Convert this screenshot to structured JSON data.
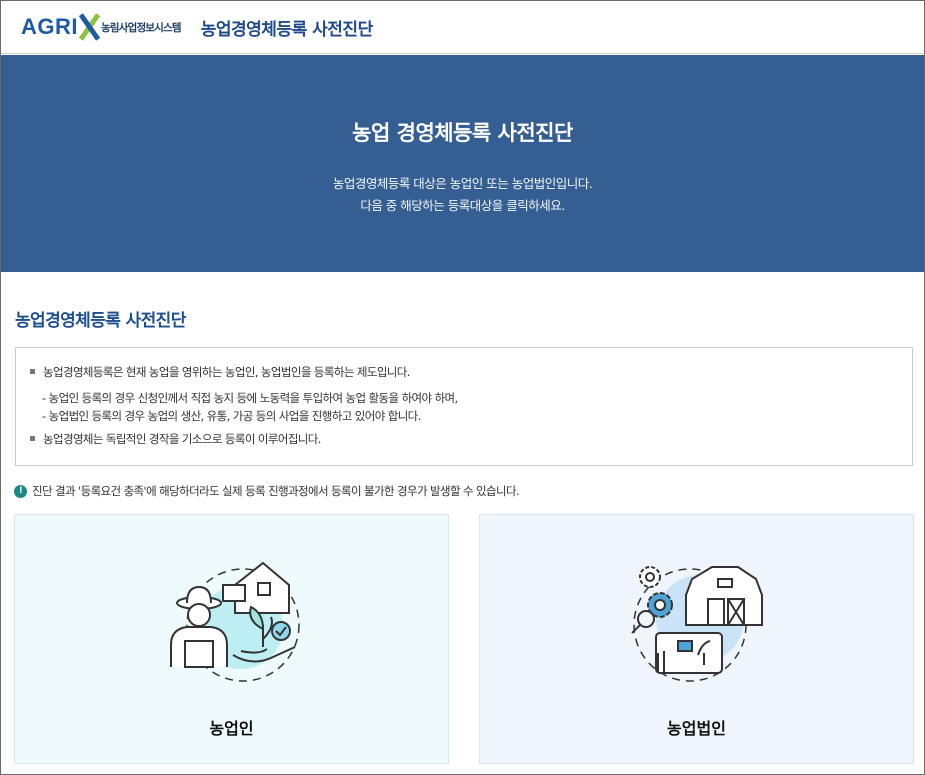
{
  "header": {
    "logo_word": "AGRI",
    "logo_subtitle": "농림사업정보시스템",
    "site_title": "농업경영체등록 사전진단"
  },
  "hero": {
    "title": "농업 경영체등록 사전진단",
    "line1": "농업경영체등록 대상은 농업인 또는 농업법인입니다.",
    "line2": "다음 중 해당하는 등록대상을 클릭하세요."
  },
  "section": {
    "title": "농업경영체등록 사전진단"
  },
  "info": {
    "items": [
      "농업경영체등록은 현재 농업을 영위하는 농업인, 농업법인을 등록하는 제도입니다.",
      "- 농업인 등록의 경우 신청인께서 직접 농지 등에 노동력을 투입하여 농업 활동을 하여야 하며,",
      "- 농업법인 등록의 경우 농업의 생산, 유통, 가공 등의 사업을 진행하고 있어야 합니다.",
      "농업경영체는 독립적인 경작을 기소으로 등록이 이루어집니다."
    ]
  },
  "notice": {
    "icon": "!",
    "text": "진단 결과 '등록요건 충족'에 해당하더라도 실제 등록 진행과정에서 등록이 불가한 경우가 발생할 수 있습니다."
  },
  "cards": [
    {
      "label": "농업인",
      "icon": "farmer-icon"
    },
    {
      "label": "농업법인",
      "icon": "farm-corporation-icon"
    }
  ],
  "colors": {
    "hero_bg": "#355e92",
    "accent": "#1d4f8e",
    "logo_green": "#8bc53f"
  }
}
